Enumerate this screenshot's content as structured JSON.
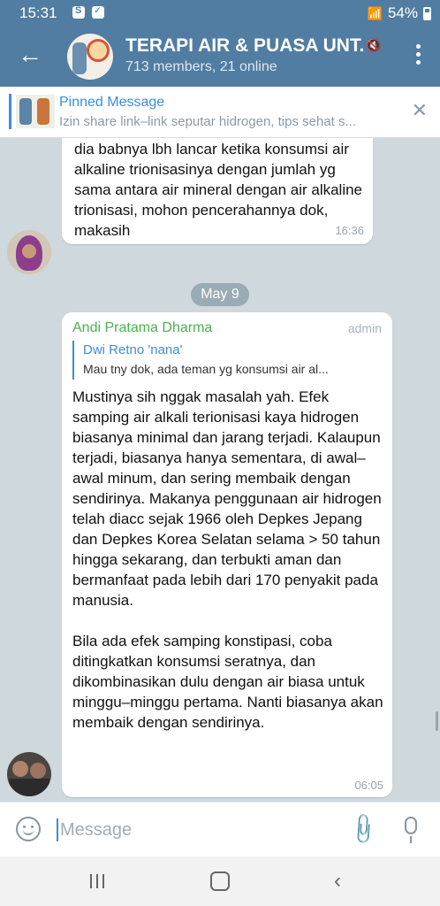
{
  "status_bar": {
    "time": "15:31",
    "battery": "54%"
  },
  "header": {
    "title": "TERAPI AIR & PUASA UNT...",
    "subtitle": "713 members, 21 online"
  },
  "pinned": {
    "title": "Pinned Message",
    "text": "Izin share link–link seputar hidrogen, tips sehat s..."
  },
  "messages": [
    {
      "text": "di minum air mineral biasa, malah mnurut dia babnya lbh lancar ketika konsumsi air alkaline trionisasinya dengan jumlah yg sama antara air mineral dengan air alkaline trionisasi, mohon pencerahannya dok, makasih",
      "time": "16:36"
    }
  ],
  "date_divider": "May 9",
  "reply_message": {
    "sender": "Andi Pratama Dharma",
    "role": "admin",
    "quoted_name": "Dwi Retno 'nana'",
    "quoted_text": "Mau tny dok, ada teman yg konsumsi air al...",
    "text": "Mustinya sih nggak masalah yah. Efek samping air alkali terionisasi kaya hidrogen biasanya minimal dan jarang terjadi. Kalaupun terjadi, biasanya hanya sementara, di awal–awal minum, dan sering membaik dengan sendirinya. Makanya penggunaan air hidrogen telah diacc sejak 1966 oleh Depkes Jepang dan Depkes Korea Selatan selama > 50 tahun hingga sekarang, dan terbukti aman dan bermanfaat pada lebih dari 170 penyakit pada manusia.\n\nBila ada efek samping konstipasi, coba ditingkatkan konsumsi seratnya, dan dikombinasikan dulu dengan air biasa untuk minggu–minggu pertama. Nanti biasanya akan membaik dengan sendirinya.",
    "time": "06:05"
  },
  "input": {
    "placeholder": "Message"
  },
  "colors": {
    "header": "#517da2",
    "accent": "#3c8edb",
    "sender": "#4caf50"
  }
}
